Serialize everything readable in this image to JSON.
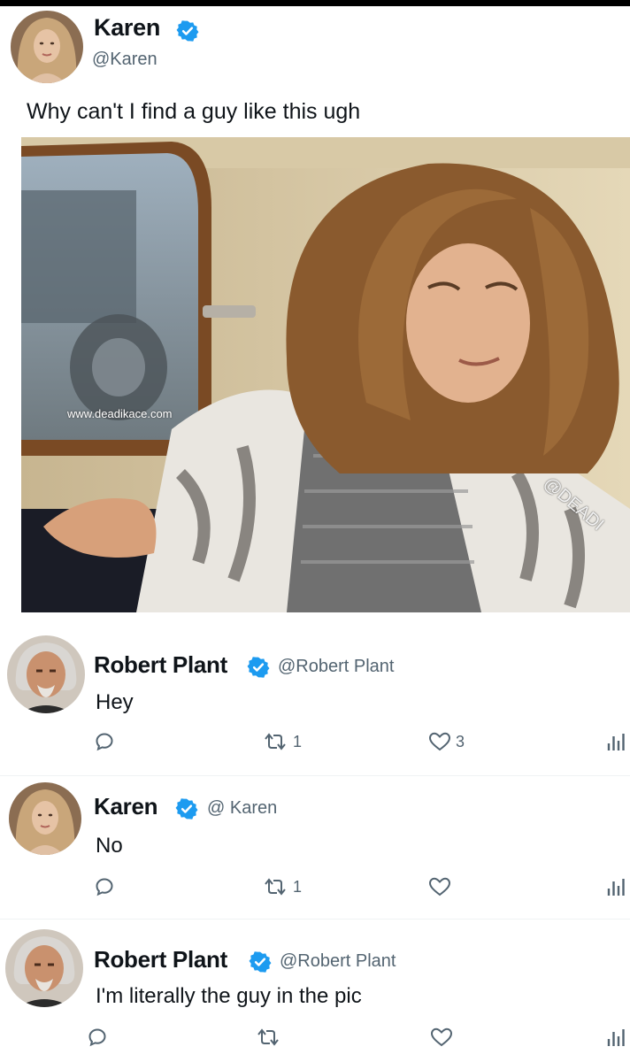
{
  "main_tweet": {
    "author_name": "Karen",
    "author_handle": "@Karen",
    "text": "Why can't I find a guy like this ugh",
    "image_watermarks": [
      "www.deadikace.com",
      "@DEADI",
      "@DEADIKACE"
    ]
  },
  "replies": [
    {
      "author_name": "Robert Plant",
      "author_handle": "@Robert Plant",
      "text": "Hey",
      "retweets": "1",
      "likes": "3"
    },
    {
      "author_name": "Karen",
      "author_handle": "@ Karen",
      "text": "No",
      "retweets": "1",
      "likes": ""
    },
    {
      "author_name": "Robert Plant",
      "author_handle": "@Robert Plant",
      "text": "I'm literally the guy in the pic",
      "retweets": "",
      "likes": ""
    }
  ],
  "icons": {
    "verified": "verified-badge-icon",
    "reply": "reply-icon",
    "retweet": "retweet-icon",
    "like": "heart-icon",
    "views": "analytics-icon"
  },
  "colors": {
    "verified_blue": "#1d9bf0",
    "secondary_text": "#536471",
    "divider": "#eff3f4"
  }
}
